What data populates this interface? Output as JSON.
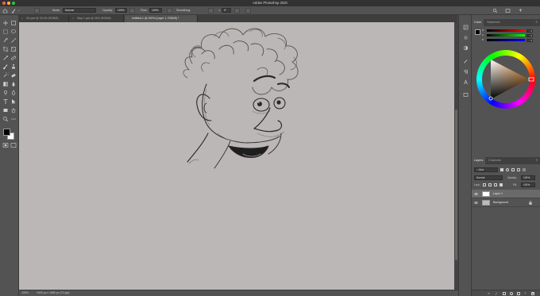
{
  "app_title": "Adobe Photoshop 2020",
  "options_bar": {
    "mode_label": "Mode:",
    "mode_value": "Normal",
    "opacity_label": "Opacity:",
    "opacity_value": "100%",
    "flow_label": "Flow:",
    "flow_value": "100%",
    "smoothing_label": "Smoothing:",
    "angle_value": "0°"
  },
  "document_tabs": [
    {
      "label": "SS.psd @ 33.3% (RGB/8)",
      "active": false
    },
    {
      "label": "Map 1.psd @ 25% (RGB/8)",
      "active": false
    },
    {
      "label": "Untitled-1 @ 100% (Layer 1, RGB/8) *",
      "active": true
    }
  ],
  "status_bar": {
    "zoom": "100%",
    "doc_size": "1920 px x 1080 px (72 ppi)"
  },
  "color_panel": {
    "tabs": [
      "Color",
      "Swatches"
    ],
    "active_tab": "Color",
    "channels": [
      {
        "label": "R",
        "value": "0"
      },
      {
        "label": "G",
        "value": "0"
      },
      {
        "label": "B",
        "value": "0"
      }
    ]
  },
  "layers_panel": {
    "tabs": [
      "Layers",
      "Channels"
    ],
    "active_tab": "Layers",
    "filter_label": "Kind",
    "blend_mode": "Normal",
    "opacity_label": "Opacity:",
    "opacity_value": "100%",
    "lock_label": "Lock:",
    "fill_label": "Fill:",
    "fill_value": "100%",
    "layers": [
      {
        "name": "Layer 1",
        "selected": true
      },
      {
        "name": "Background",
        "selected": false
      }
    ]
  },
  "colors": {
    "canvas": "#bbb7b6",
    "panel": "#535353",
    "accent_orange": "#ff9d3a"
  }
}
